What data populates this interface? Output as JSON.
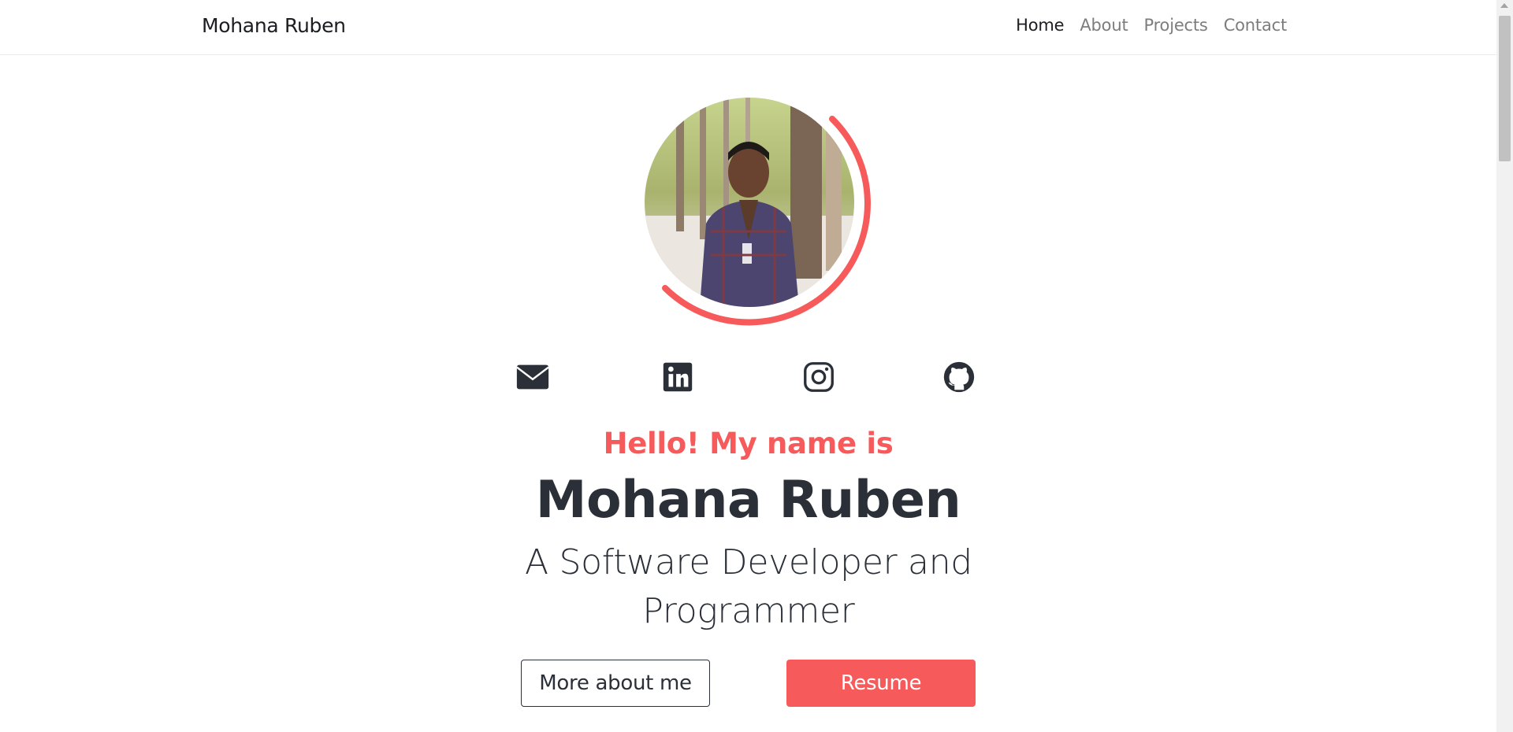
{
  "navbar": {
    "brand": "Mohana Ruben",
    "links": [
      {
        "label": "Home",
        "active": true
      },
      {
        "label": "About",
        "active": false
      },
      {
        "label": "Projects",
        "active": false
      },
      {
        "label": "Contact",
        "active": false
      }
    ]
  },
  "profile": {
    "photo_icon": "profile-photo",
    "accent_color": "#f65a5a"
  },
  "social": [
    {
      "icon": "envelope-icon"
    },
    {
      "icon": "linkedin-icon"
    },
    {
      "icon": "instagram-icon"
    },
    {
      "icon": "github-icon"
    }
  ],
  "hero": {
    "greeting": "Hello! My name is",
    "name": "Mohana Ruben",
    "tagline": "A Software Developer and Programmer"
  },
  "buttons": {
    "more_about": "More about me",
    "resume": "Resume"
  },
  "colors": {
    "accent": "#f65a5a",
    "text": "#2b3038",
    "muted": "#7d7d7d"
  }
}
